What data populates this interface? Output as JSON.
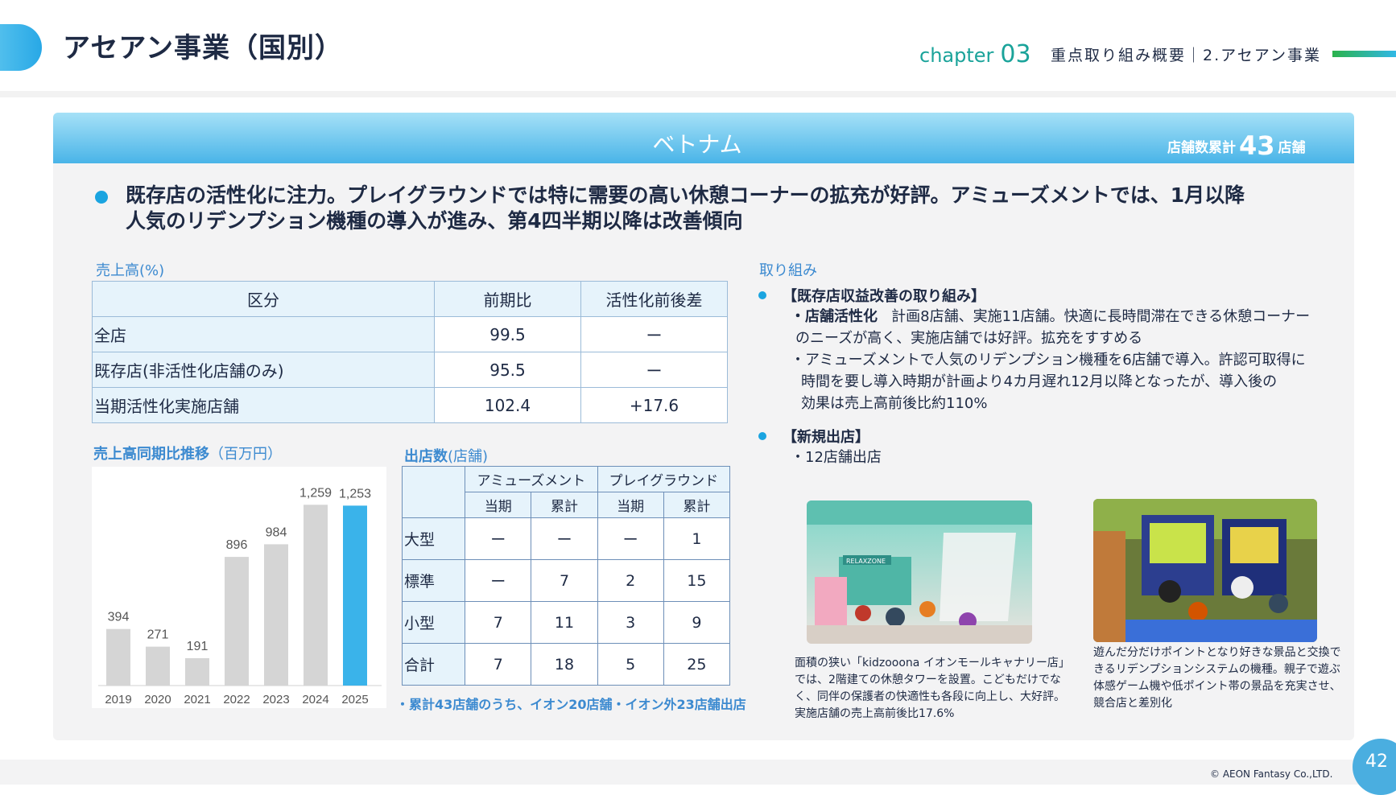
{
  "header": {
    "title": "アセアン事業（国別）",
    "chapter_label": "chapter",
    "chapter_number": "03",
    "section": "重点取り組み概要｜2.アセアン事業"
  },
  "panel": {
    "country": "ベトナム",
    "store_count_label": "店舗数累計",
    "store_count": "43",
    "store_count_unit": "店舗"
  },
  "lead": {
    "line1": "既存店の活性化に注力。プレイグラウンドでは特に需要の高い休憩コーナーの拡充が好評。アミューズメントでは、1月以降",
    "line2": "人気のリデンプション機種の導入が進み、第4四半期以降は改善傾向"
  },
  "sales_table": {
    "label": "売上高(%)",
    "headers": [
      "区分",
      "前期比",
      "活性化前後差"
    ],
    "rows": [
      [
        "全店",
        "99.5",
        "ー"
      ],
      [
        "既存店(非活性化店舗のみ)",
        "95.5",
        "ー"
      ],
      [
        "当期活性化実施店舗",
        "102.4",
        "+17.6"
      ]
    ]
  },
  "chart_label": {
    "main": "売上高同期比推移",
    "unit": "（百万円）"
  },
  "chart_data": {
    "type": "bar",
    "categories": [
      "2019",
      "2020",
      "2021",
      "2022",
      "2023",
      "2024",
      "2025"
    ],
    "values": [
      394,
      271,
      191,
      896,
      984,
      1259,
      1253
    ],
    "value_labels": [
      "394",
      "271",
      "191",
      "896",
      "984",
      "1,259",
      "1,253"
    ],
    "ylim": [
      0,
      1300
    ],
    "colors": {
      "default": "#d5d5d5",
      "highlight": "#3ab3ea"
    },
    "highlight_index": 6
  },
  "store_table": {
    "label_main": "出店数",
    "label_unit": "(店舗)",
    "group_headers": [
      "アミューズメント",
      "プレイグラウンド"
    ],
    "sub_headers": [
      "当期",
      "累計",
      "当期",
      "累計"
    ],
    "rows": [
      [
        "大型",
        "ー",
        "ー",
        "ー",
        "1"
      ],
      [
        "標準",
        "ー",
        "7",
        "2",
        "15"
      ],
      [
        "小型",
        "7",
        "11",
        "3",
        "9"
      ],
      [
        "合計",
        "7",
        "18",
        "5",
        "25"
      ]
    ],
    "note": "・累計43店舗のうち、イオン20店舗・イオン外23店舗出店"
  },
  "initiatives": {
    "label": "取り組み",
    "item1_heading": "【既存店収益改善の取り組み】",
    "item1_sub1_bold": "・店舗活性化",
    "item1_sub1_text": "計画8店舗、実施11店舗。快適に長時間滞在できる休憩コーナー",
    "item1_sub1_text2": "のニーズが高く、実施店舗では好評。拡充をすすめる",
    "item1_sub2_line1": "・アミューズメントで人気のリデンプション機種を6店舗で導入。許認可取得に",
    "item1_sub2_line2": "時間を要し導入時期が計画より4カ月遅れ12月以降となったが、導入後の",
    "item1_sub2_line3": "効果は売上高前後比約110%",
    "item2_heading": "【新規出店】",
    "item2_text": "・12店舗出店"
  },
  "photos": {
    "photo1_caption": [
      "面積の狭い「kidzooona イオンモールキャナリー店」",
      "では、2階建ての休憩タワーを設置。こどもだけでな",
      "く、同伴の保護者の快適性も各段に向上し、大好評。",
      "実施店舗の売上高前後比17.6%"
    ],
    "photo1_sign": "RELAXZONE",
    "photo2_caption": [
      "遊んだ分だけポイントとなり好きな景品と交換で",
      "きるリデンプションシステムの機種。親子で遊ぶ",
      "体感ゲーム機や低ポイント帯の景品を充実させ、",
      "競合店と差別化"
    ]
  },
  "footer": {
    "copyright": "© AEON Fantasy Co.,LTD.",
    "page_number": "42"
  }
}
